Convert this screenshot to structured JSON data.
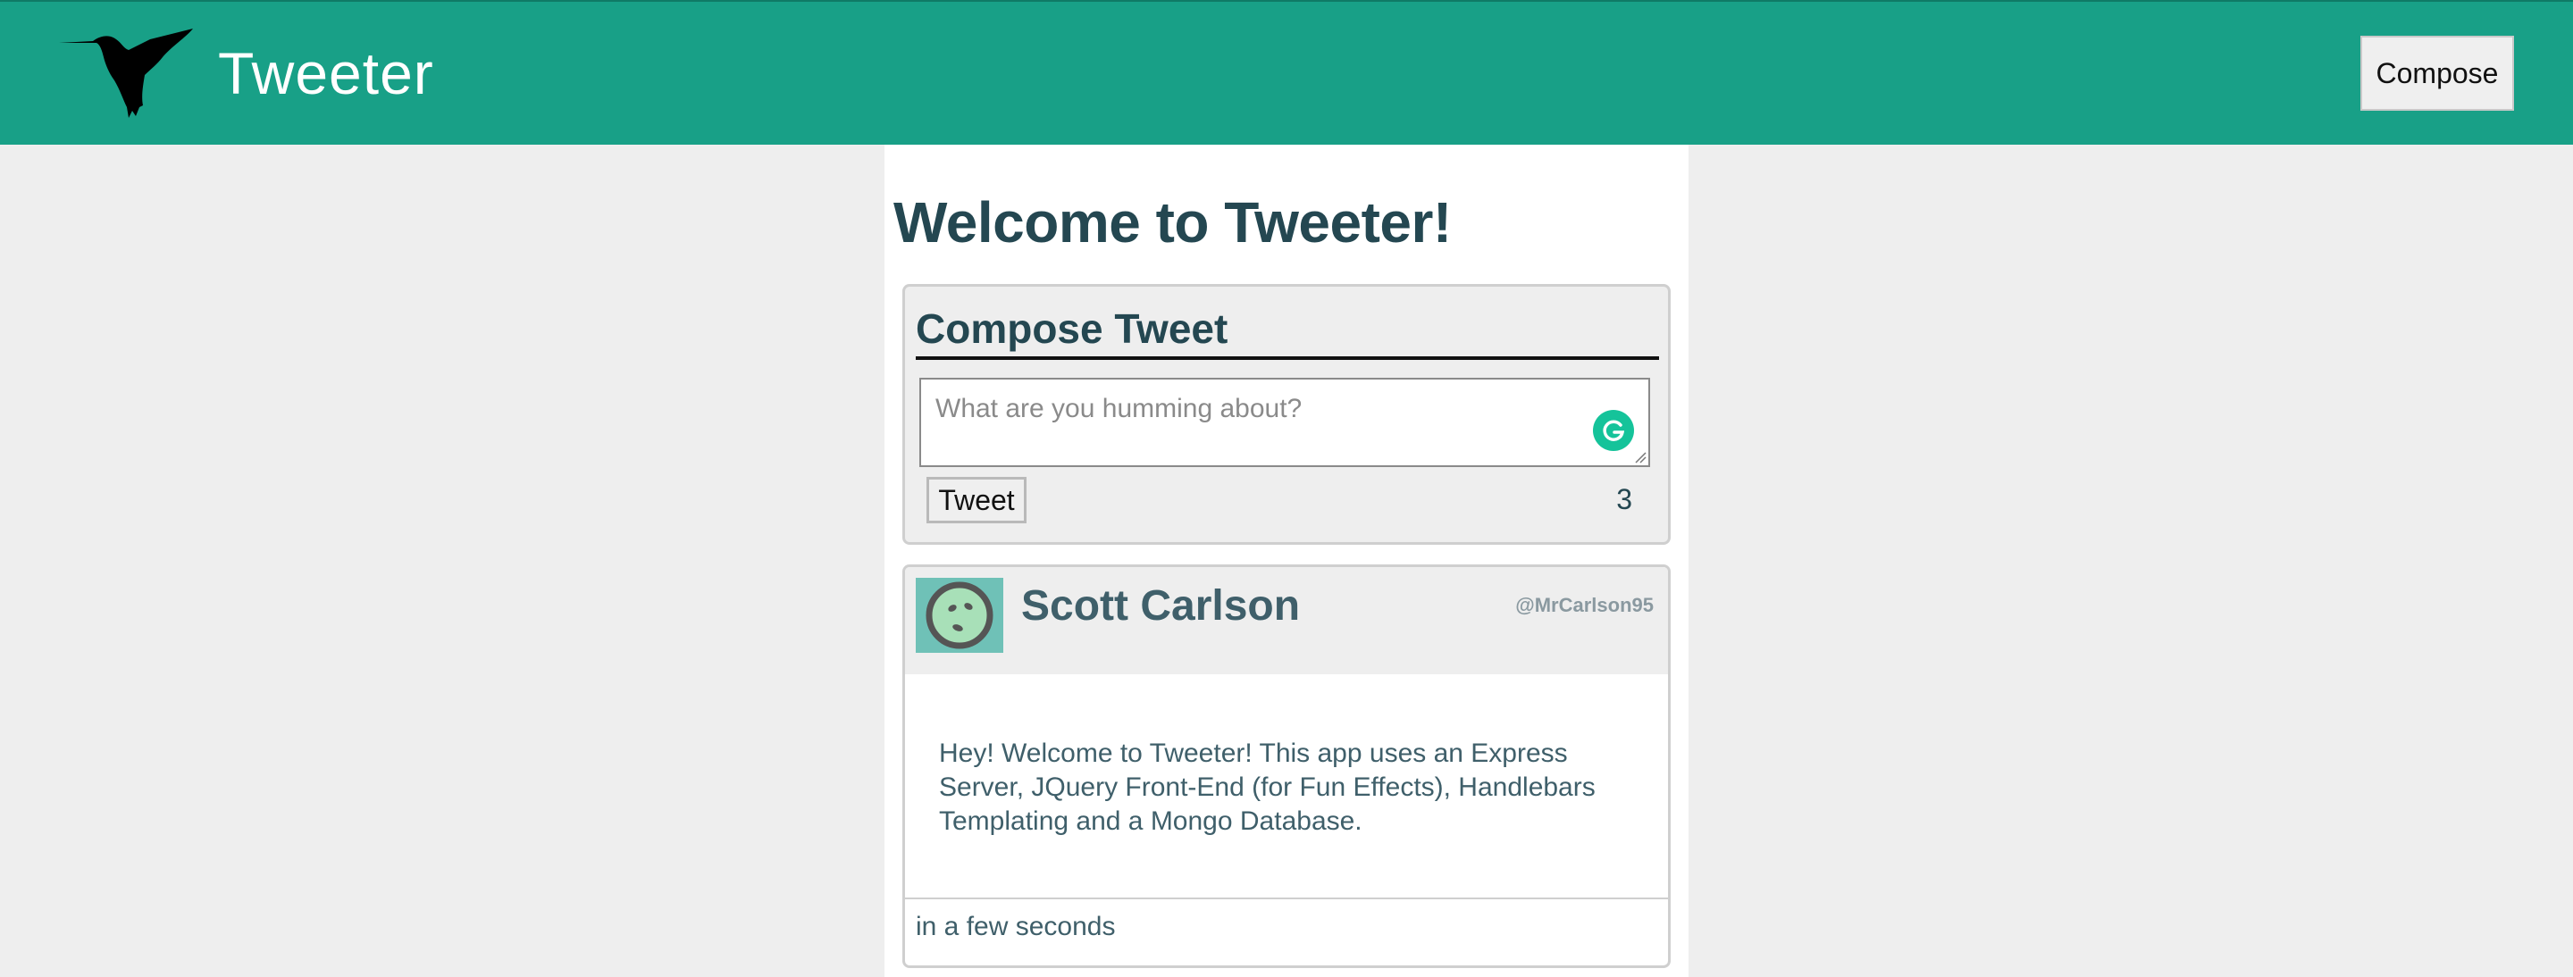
{
  "nav": {
    "brand": "Tweeter",
    "compose_label": "Compose",
    "logo_icon": "hummingbird-icon",
    "bg_color": "#18a087"
  },
  "page": {
    "title": "Welcome to Tweeter!"
  },
  "compose": {
    "heading": "Compose Tweet",
    "placeholder": "What are you humming about?",
    "tweet_button": "Tweet",
    "char_counter": "3",
    "grammarly_icon": "grammarly-icon"
  },
  "tweets": [
    {
      "author": "Scott Carlson",
      "handle": "@MrCarlson95",
      "avatar_icon": "avatar-icon",
      "body": "Hey! Welcome to Tweeter! This app uses an Express Server, JQuery Front-End (for Fun Effects), Handlebars Templating and a Mongo Database.",
      "timestamp": "in a few seconds"
    }
  ],
  "colors": {
    "accent": "#18a087",
    "heading": "#244751",
    "text": "#3f5f6a"
  }
}
